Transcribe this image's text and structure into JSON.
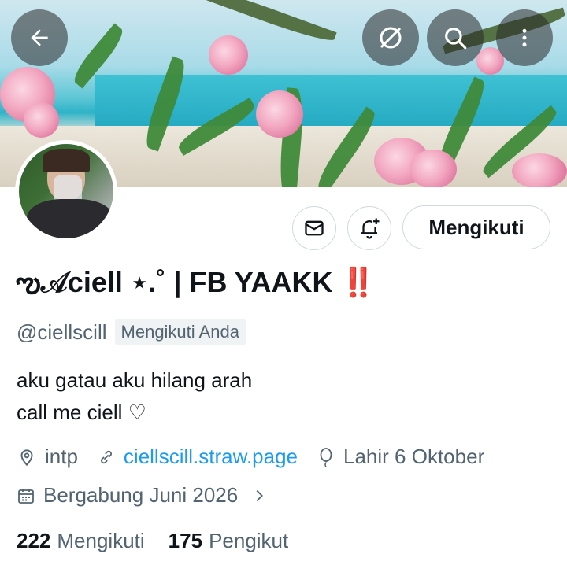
{
  "profile": {
    "display_name": "ఌ𝒜ciell ⋆.˚ | FB YAAKK",
    "display_name_emoji": "‼️",
    "handle": "@ciellscill",
    "follows_you": "Mengikuti Anda",
    "bio_line1": "aku gatau aku hilang arah",
    "bio_line2": "call me ciell ♡",
    "category": "intp",
    "website": "ciellscill.straw.page",
    "birthday": "Lahir 6 Oktober",
    "joined": "Bergabung Juni 2026",
    "following_count": "222",
    "following_label": "Mengikuti",
    "followers_count": "175",
    "followers_label": "Pengikut"
  },
  "actions": {
    "follow_button": "Mengikuti"
  },
  "icons": {
    "back": "arrow-left-icon",
    "translate": "no-grok-icon",
    "search": "search-icon",
    "more": "more-vertical-icon",
    "message": "envelope-icon",
    "notify": "bell-plus-icon",
    "location": "location-pin-icon",
    "link": "link-icon",
    "birthday": "balloon-icon",
    "calendar": "calendar-icon",
    "chevron": "chevron-right-icon"
  },
  "colors": {
    "link": "#1d9bf0",
    "muted": "#536471",
    "text": "#0f1419",
    "emoji_red": "#e0245e"
  }
}
